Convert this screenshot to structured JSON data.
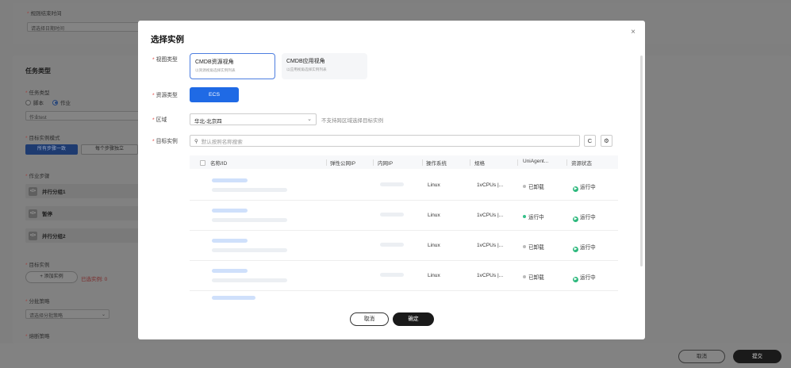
{
  "background": {
    "rule_end_time_label": "规则结束时间",
    "date_placeholder": "请选择日期时间",
    "task_type_title": "任务类型",
    "task_type_label": "任务类型",
    "radio_script": "脚本",
    "radio_job": "作业",
    "job_value": "作业test",
    "target_mode_label": "目标实例模式",
    "mode_same": "所有步骤一致",
    "mode_each": "每个步骤独立",
    "steps_label": "作业步骤",
    "steps": [
      "并行分组1",
      "暂停",
      "并行分组2"
    ],
    "target_instance_label": "目标实例",
    "add_instance": "+ 添加实例",
    "selected_count": "已选实例: 0",
    "batch_label": "分批策略",
    "batch_placeholder": "请选择分批策略",
    "circuit_label": "熔断策略",
    "footer_cancel": "取消",
    "footer_submit": "提交"
  },
  "modal": {
    "title": "选择实例",
    "close": "×",
    "view_type_label": "视图类型",
    "view_cards": [
      {
        "title": "CMDB资源视角",
        "sub": "以资源视角选择实例列表"
      },
      {
        "title": "CMDB应用视角",
        "sub": "以应用视角选择实例列表"
      }
    ],
    "resource_type_label": "资源类型",
    "resource_type_value": "ECS",
    "region_label": "区域",
    "region_value": "华北-北京四",
    "region_hint": "不支持跨区域选择目标实例",
    "target_label": "目标实例",
    "search_placeholder": "默认按照名称搜索",
    "refresh_icon": "C",
    "settings_icon": "⚙",
    "table_headers": [
      "名称/ID",
      "弹性公网IP",
      "内网IP",
      "操作系统",
      "规格",
      "UniAgent...",
      "资源状态"
    ],
    "rows": [
      {
        "os": "Linux",
        "spec": "1vCPUs |...",
        "agent": "已卸载",
        "agent_status": "grey",
        "status": "运行中"
      },
      {
        "os": "Linux",
        "spec": "1vCPUs |...",
        "agent": "运行中",
        "agent_status": "green",
        "status": "运行中"
      },
      {
        "os": "Linux",
        "spec": "1vCPUs |...",
        "agent": "已卸载",
        "agent_status": "grey",
        "status": "运行中"
      },
      {
        "os": "Linux",
        "spec": "1vCPUs |...",
        "agent": "已卸载",
        "agent_status": "grey",
        "status": "运行中"
      }
    ],
    "cancel": "取消",
    "confirm": "确定"
  }
}
